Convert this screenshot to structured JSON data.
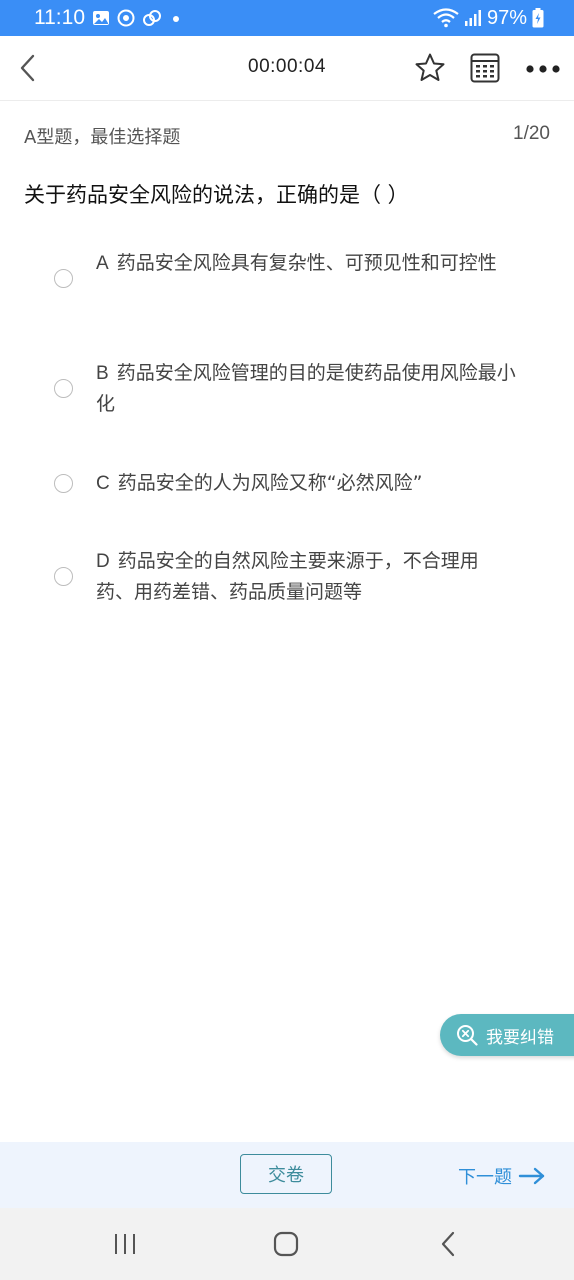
{
  "status_bar": {
    "time": "11:10",
    "battery": "97%",
    "icons_left": [
      "image-icon",
      "sync-icon",
      "link-icon",
      "dot-icon"
    ],
    "icons_right": [
      "wifi-icon",
      "signal-icon",
      "battery-icon"
    ],
    "background": "#3a8ef6"
  },
  "top_nav": {
    "timer": "00:00:04",
    "icons": [
      "back-icon",
      "star-icon",
      "answer-card-icon",
      "more-icon"
    ]
  },
  "question": {
    "type_label": "A型题，最佳选择题",
    "progress": "1/20",
    "stem": "关于药品安全风险的说法，正确的是（ ）",
    "options": [
      {
        "letter": "A",
        "text": "药品安全风险具有复杂性、可预见性和可控性"
      },
      {
        "letter": "B",
        "text": "药品安全风险管理的目的是使药品使用风险最小化"
      },
      {
        "letter": "C",
        "text": "药品安全的人为风险又称“必然风险”"
      },
      {
        "letter": "D",
        "text": "药品安全的自然风险主要来源于，不合理用药、用药差错、药品质量问题等"
      }
    ]
  },
  "correction_button": {
    "label": "我要纠错",
    "color": "#5cb8c0"
  },
  "bottom_bar": {
    "submit_label": "交卷",
    "next_label": "下一题",
    "accent": "#2f8fd8"
  },
  "system_nav": {
    "icons": [
      "recent-apps-icon",
      "home-icon",
      "system-back-icon"
    ]
  }
}
